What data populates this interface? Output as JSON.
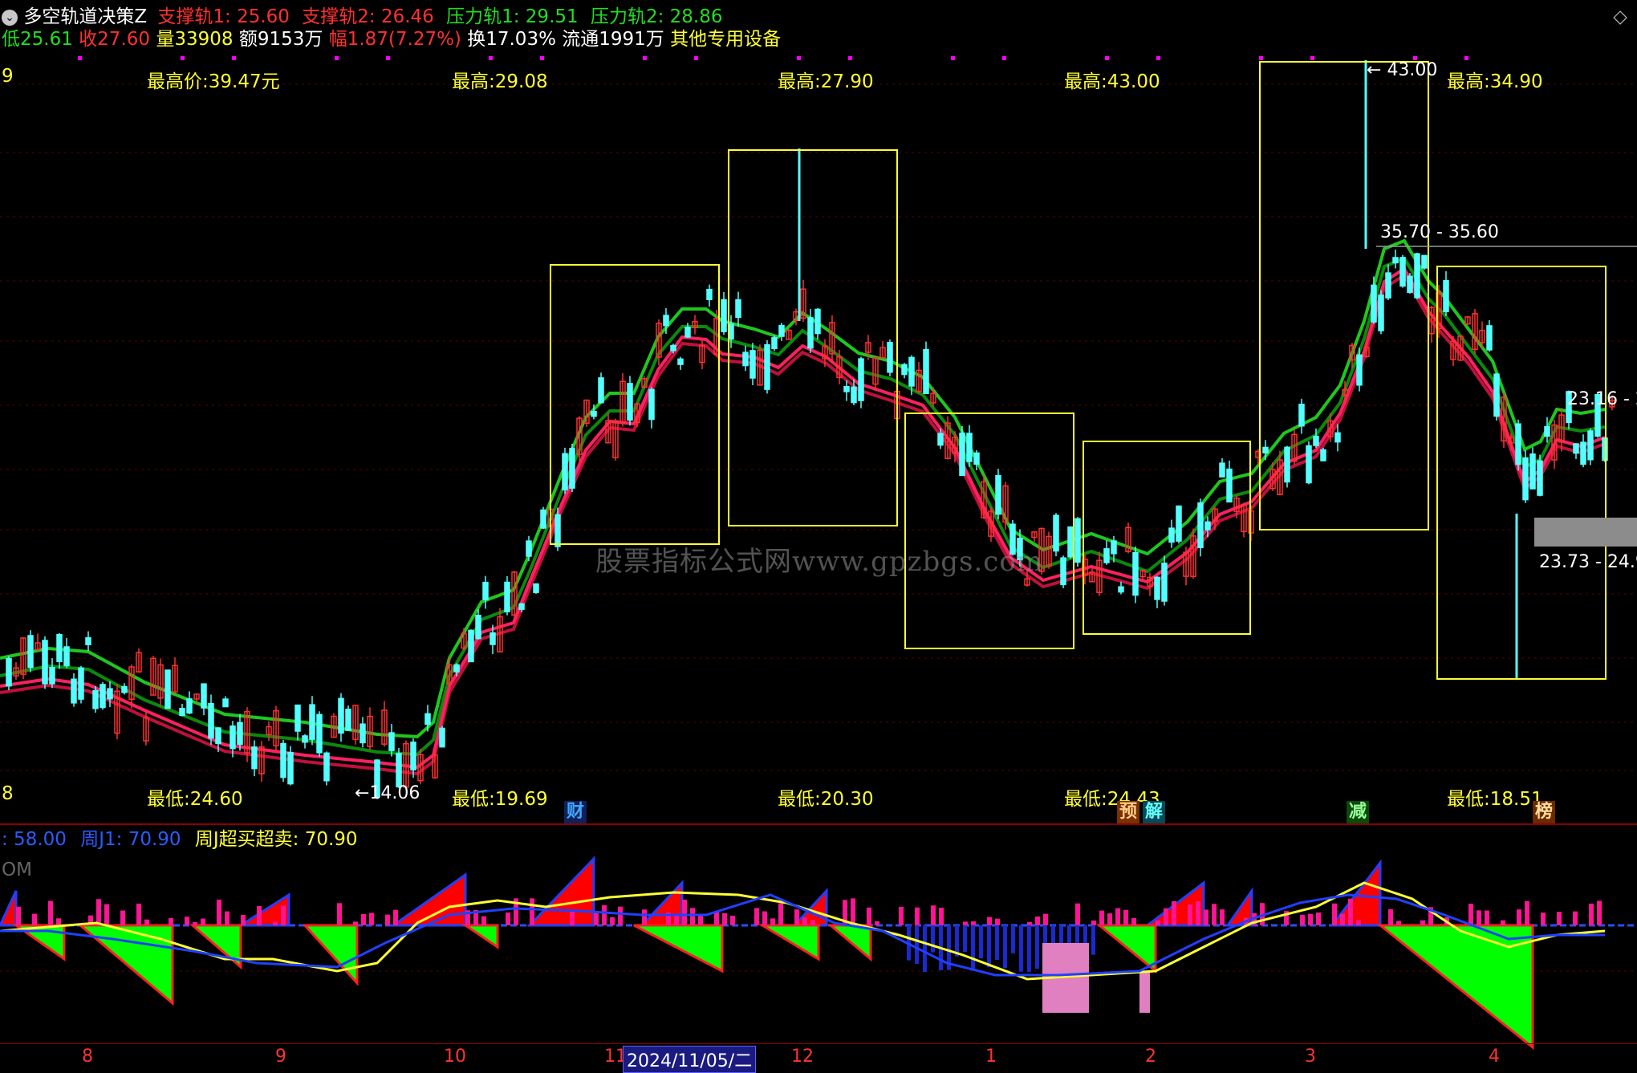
{
  "header": {
    "indicator_name": "多空轨道决策Z",
    "support1": "支撑轨1: 25.60",
    "support2": "支撑轨2: 26.46",
    "pressure1": "压力轨1: 29.51",
    "pressure2": "压力轨2: 28.86",
    "low": "低25.61",
    "close": "收27.60",
    "volume": "量33908",
    "amount": "额9153万",
    "amplitude": "幅1.87(7.27%)",
    "turnover": "换17.03%",
    "float": "流通1991万",
    "sector": "其他专用设备",
    "top_left_cut": "9",
    "bottom_left_cut": "8"
  },
  "highs": [
    "最高价:39.47元",
    "最高:29.08",
    "最高:27.90",
    "最高:43.00",
    "最高:34.90"
  ],
  "lows": [
    "最低:24.60",
    "最低:19.69",
    "最低:20.30",
    "最低:24.43",
    "最低:18.51"
  ],
  "price_marks": {
    "peak": "43.00",
    "trough": "14.06",
    "zone_upper": "35.70 - 35.60",
    "zone_mid": "23.16 - 2",
    "zone_lower": "23.73 - 24.9"
  },
  "event_tags": [
    {
      "text": "财",
      "color": "#3fa9ff",
      "bg": "#10205a"
    },
    {
      "text": "预",
      "color": "#ffcc88",
      "bg": "#7a3000"
    },
    {
      "text": "解",
      "color": "#66ffff",
      "bg": "#004a5a"
    },
    {
      "text": "减",
      "color": "#99ff99",
      "bg": "#0a4a0a"
    },
    {
      "text": "榜",
      "color": "#ffdd99",
      "bg": "#6a2a00"
    }
  ],
  "indicator": {
    "cut_value": ": 58.00",
    "j1": "周J1: 70.90",
    "j_label": "周J超买超卖: 70.90",
    "om": "OM"
  },
  "x_axis": [
    "8",
    "9",
    "10",
    "11",
    "12",
    "1",
    "2",
    "3",
    "4"
  ],
  "current_date": "2024/11/05/二",
  "watermark": "股票指标公式网www.gpzbgs.com",
  "colors": {
    "up": "#ff3030",
    "down": "#54ffff",
    "pressure": "#1ec81e",
    "pressure2": "#0a8a0a",
    "support": "#ff2060",
    "box": "#ffff33",
    "label": "#ffff33",
    "magenta": "#ff00ff"
  }
}
